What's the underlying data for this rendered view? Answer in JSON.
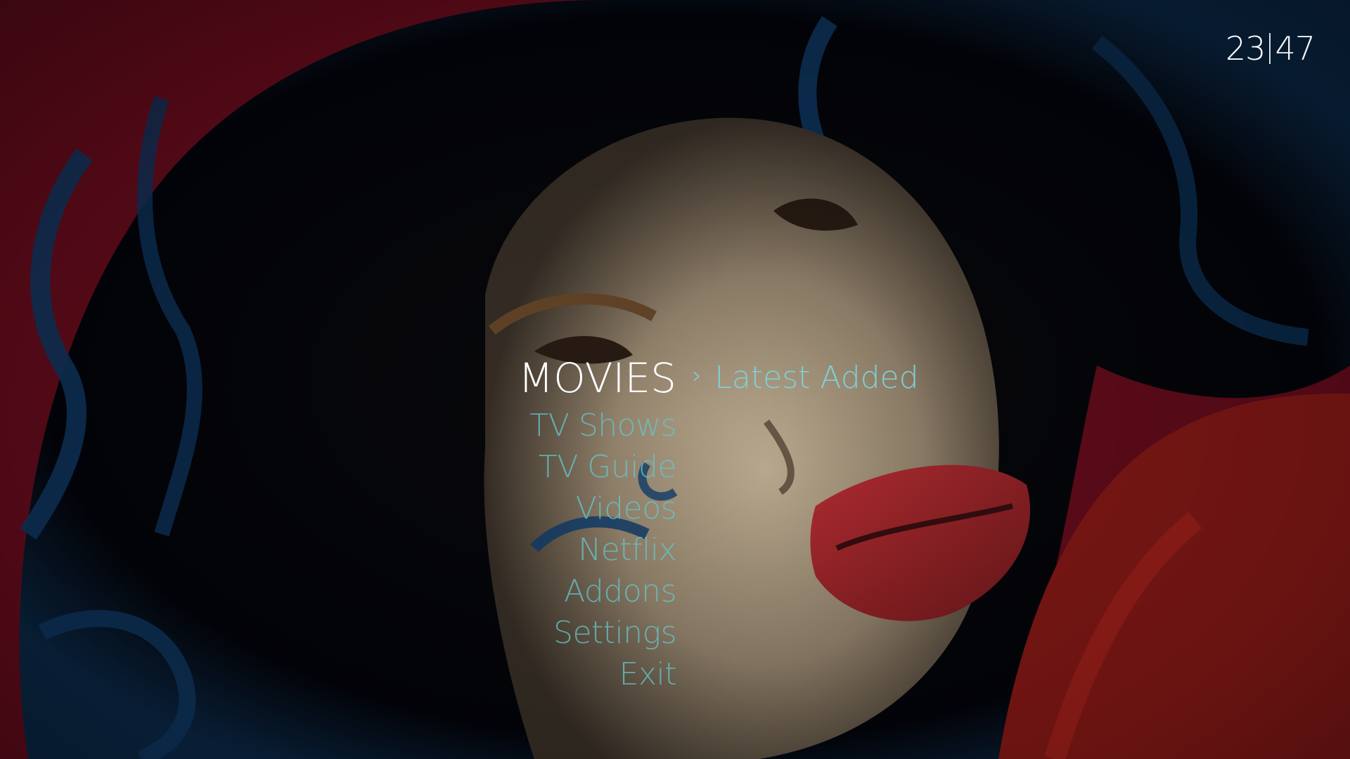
{
  "clock": {
    "hours": "23",
    "minutes": "47"
  },
  "menu": {
    "items": [
      {
        "label": "MOVIES",
        "selected": true
      },
      {
        "label": "TV Shows",
        "selected": false
      },
      {
        "label": "TV Guide",
        "selected": false
      },
      {
        "label": "Videos",
        "selected": false
      },
      {
        "label": "Netflix",
        "selected": false
      },
      {
        "label": "Addons",
        "selected": false
      },
      {
        "label": "Settings",
        "selected": false
      },
      {
        "label": "Exit",
        "selected": false
      }
    ]
  },
  "submenu": {
    "label": "Latest Added",
    "icon": "chevron-right-icon"
  },
  "colors": {
    "accent": "#7fd0d4",
    "menu_inactive": "#66c4c8",
    "menu_active": "#ffffff",
    "background": "#6b0c1e"
  }
}
